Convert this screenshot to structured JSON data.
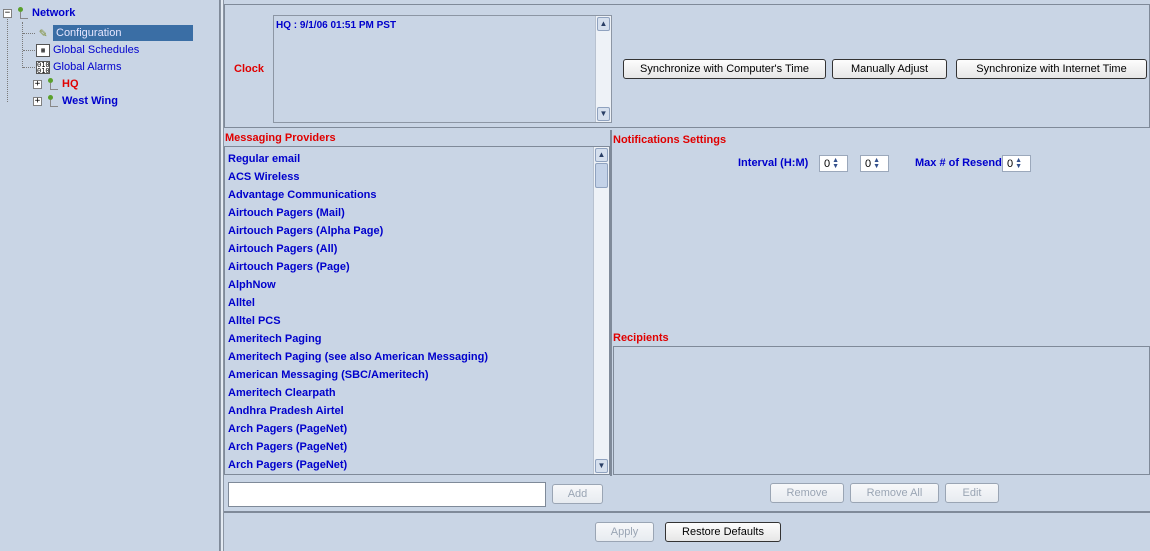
{
  "tree": {
    "root": "Network",
    "items": [
      {
        "label": "Configuration",
        "icon": "wrench-icon",
        "selected": true
      },
      {
        "label": "Global Schedules",
        "icon": "calendar-icon"
      },
      {
        "label": "Global Alarms",
        "icon": "binary-icon"
      }
    ],
    "sites": [
      {
        "label": "HQ",
        "color": "#e00000"
      },
      {
        "label": "West Wing",
        "color": "#0000cc"
      }
    ]
  },
  "clock": {
    "label": "Clock",
    "display_text": "HQ : 9/1/06 01:51 PM PST",
    "buttons": {
      "sync_computer": "Synchronize with Computer's Time",
      "manual": "Manually Adjust",
      "sync_internet": "Synchronize with Internet Time"
    }
  },
  "messaging": {
    "title": "Messaging Providers",
    "providers": [
      "Regular email",
      "ACS Wireless",
      "Advantage Communications",
      "Airtouch Pagers (Mail)",
      "Airtouch Pagers (Alpha Page)",
      "Airtouch Pagers (All)",
      "Airtouch Pagers (Page)",
      "AlphNow",
      "Alltel",
      "Alltel PCS",
      "Ameritech Paging",
      "Ameritech Paging (see also American Messaging)",
      "American Messaging (SBC/Ameritech)",
      "Ameritech Clearpath",
      "Andhra Pradesh Airtel",
      "Arch Pagers (PageNet)",
      "Arch Pagers (PageNet)",
      "Arch Pagers (PageNet)"
    ],
    "add_value": "",
    "add_label": "Add"
  },
  "notifications": {
    "title": "Notifications Settings",
    "interval_label": "Interval (H:M)",
    "hours": "0",
    "minutes": "0",
    "resend_label": "Max # of Resend",
    "resend": "0"
  },
  "recipients": {
    "title": "Recipients",
    "remove_label": "Remove",
    "remove_all_label": "Remove All",
    "edit_label": "Edit"
  },
  "footer": {
    "apply_label": "Apply",
    "restore_label": "Restore Defaults"
  },
  "colors": {
    "panel_bg": "#c9d5e5",
    "label_red": "#e00000",
    "link_blue": "#0000cc",
    "selection": "#3a6ea5"
  }
}
